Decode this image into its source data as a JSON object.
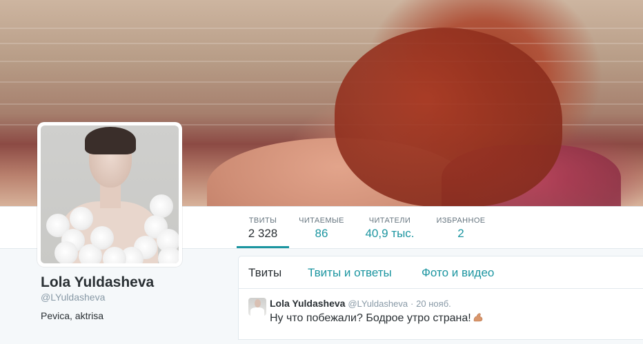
{
  "profile": {
    "name": "Lola Yuldasheva",
    "handle": "@LYuldasheva",
    "bio": "Pevica, aktrisa"
  },
  "stats": [
    {
      "label": "ТВИТЫ",
      "value": "2 328",
      "active": true
    },
    {
      "label": "ЧИТАЕМЫЕ",
      "value": "86",
      "active": false
    },
    {
      "label": "ЧИТАТЕЛИ",
      "value": "40,9 тыс.",
      "active": false
    },
    {
      "label": "ИЗБРАННОЕ",
      "value": "2",
      "active": false
    }
  ],
  "timeline": {
    "tabs": [
      {
        "label": "Твиты",
        "active": true
      },
      {
        "label": "Твиты и ответы",
        "active": false
      },
      {
        "label": "Фото и видео",
        "active": false
      }
    ],
    "tweet": {
      "author": "Lola Yuldasheva",
      "handle": "@LYuldasheva",
      "separator": "·",
      "time": "20 нояб.",
      "text": "Ну что побежали? Бодрое утро страна!",
      "emoji": "flexed-biceps-icon"
    }
  },
  "colors": {
    "accent": "#1b95a0",
    "text": "#292f33",
    "muted": "#8899a6",
    "background": "#f5f8fa"
  }
}
